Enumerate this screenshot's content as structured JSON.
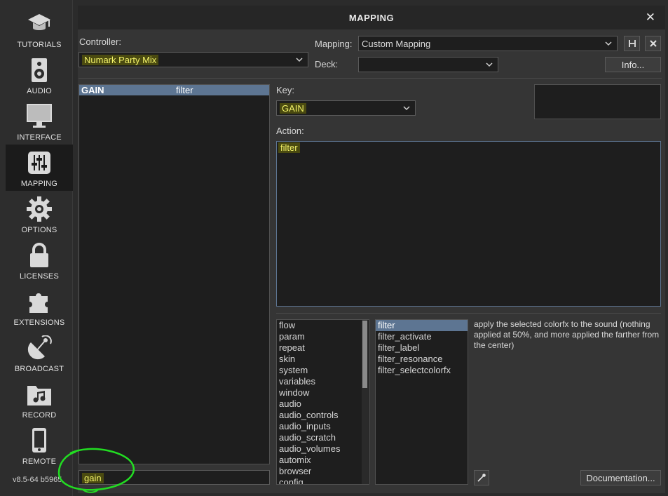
{
  "sidebar": {
    "items": [
      {
        "label": "TUTORIALS",
        "icon": "graduation-cap-icon"
      },
      {
        "label": "AUDIO",
        "icon": "speaker-icon"
      },
      {
        "label": "INTERFACE",
        "icon": "monitor-icon"
      },
      {
        "label": "MAPPING",
        "icon": "sliders-icon"
      },
      {
        "label": "OPTIONS",
        "icon": "gear-icon"
      },
      {
        "label": "LICENSES",
        "icon": "lock-icon"
      },
      {
        "label": "EXTENSIONS",
        "icon": "puzzle-icon"
      },
      {
        "label": "BROADCAST",
        "icon": "satellite-dish-icon"
      },
      {
        "label": "RECORD",
        "icon": "music-folder-icon"
      },
      {
        "label": "REMOTE",
        "icon": "phone-icon"
      }
    ],
    "active": "MAPPING",
    "version": "v8.5-64 b5965"
  },
  "window": {
    "title": "MAPPING",
    "close": "✕"
  },
  "controller": {
    "label": "Controller:",
    "value": "Numark Party Mix"
  },
  "mapping": {
    "label": "Mapping:",
    "value": "Custom Mapping"
  },
  "deck": {
    "label": "Deck:",
    "value": ""
  },
  "info_button": "Info...",
  "keys_list": [
    {
      "key": "GAIN",
      "action": "filter"
    }
  ],
  "key": {
    "label": "Key:",
    "value": "GAIN"
  },
  "action": {
    "label": "Action:",
    "value": "filter"
  },
  "categories": [
    "flow",
    "param",
    "repeat",
    "skin",
    "system",
    "variables",
    "window",
    "audio",
    "audio_controls",
    "audio_inputs",
    "audio_scratch",
    "audio_volumes",
    "automix",
    "browser",
    "config"
  ],
  "verbs": [
    "filter",
    "filter_activate",
    "filter_label",
    "filter_resonance",
    "filter_selectcolorfx"
  ],
  "description": "apply the selected colorfx to the sound (nothing applied at 50%, and more applied the farther from the center)",
  "search": {
    "value": "gain"
  },
  "documentation_button": "Documentation...",
  "colors": {
    "highlight_text": "#f3f36a",
    "highlight_bg": "#4a4a10",
    "selection": "#5d7592",
    "annotation_circle": "#22dd22"
  }
}
